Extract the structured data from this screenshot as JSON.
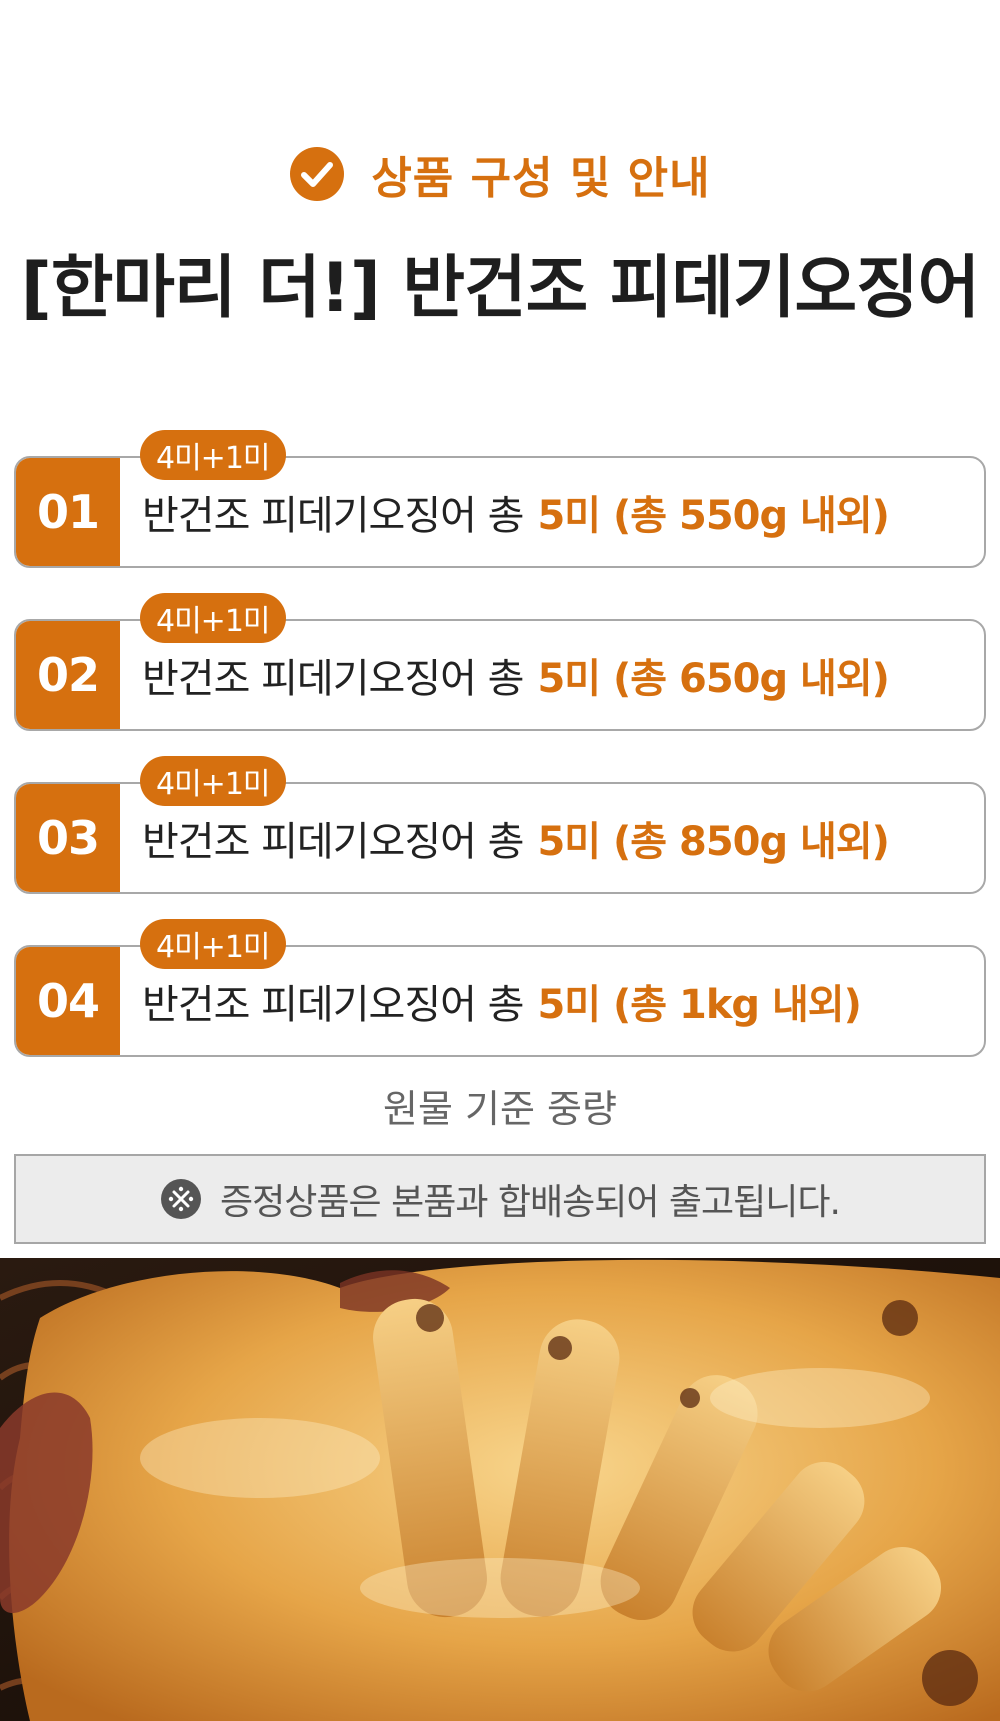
{
  "header": {
    "section_title": "상품 구성 및 안내",
    "product_title": "[한마리 더!] 반건조 피데기오징어"
  },
  "options": [
    {
      "num": "01",
      "badge": "4미+1미",
      "desc": "반건조 피데기오징어 총",
      "highlight": "5미 (총 550g 내외)"
    },
    {
      "num": "02",
      "badge": "4미+1미",
      "desc": "반건조 피데기오징어 총",
      "highlight": "5미 (총 650g 내외)"
    },
    {
      "num": "03",
      "badge": "4미+1미",
      "desc": "반건조 피데기오징어 총",
      "highlight": "5미 (총 850g 내외)"
    },
    {
      "num": "04",
      "badge": "4미+1미",
      "desc": "반건조 피데기오징어 총",
      "highlight": "5미 (총 1kg 내외)"
    }
  ],
  "weight_note": "원물 기준 중량",
  "notice": {
    "icon": "reference-mark-icon",
    "text": "증정상품은 본품과 합배송되어 출고됩니다."
  },
  "colors": {
    "accent": "#d6700f",
    "title": "#1e1e1e",
    "muted": "#666666",
    "notice_bg": "#ececec"
  },
  "photo": {
    "icon": "grilled-squid-photo"
  }
}
